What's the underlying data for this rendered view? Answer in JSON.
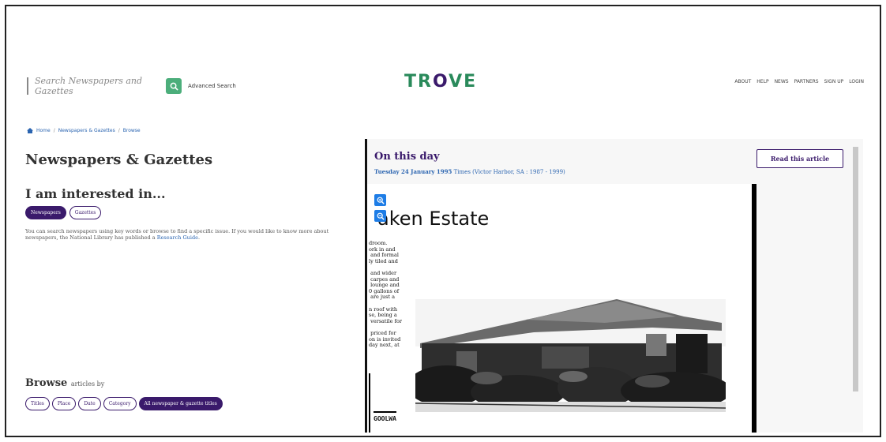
{
  "header": {
    "search_placeholder": "Search Newspapers and Gazettes",
    "advanced_search": "Advanced Search",
    "logo_left": "TR",
    "logo_o": "O",
    "logo_right": "VE",
    "nav": [
      "ABOUT",
      "HELP",
      "NEWS",
      "PARTNERS",
      "SIGN UP",
      "LOGIN"
    ]
  },
  "breadcrumb": {
    "home": "Home",
    "sep": "/",
    "items": [
      "Newspapers & Gazettes",
      "Browse"
    ]
  },
  "main": {
    "title": "Newspapers & Gazettes",
    "interest_heading": "I am interested in...",
    "interest_pills": [
      "Newspapers",
      "Gazettes"
    ],
    "description": "You can search newspapers using key words or browse to find a specific issue. If you would like to know more about newspapers, the National Library has published a ",
    "description_link": "Research Guide",
    "description_end": ".",
    "browse_heading": "Browse",
    "browse_sub": "articles by",
    "browse_pills": [
      "Titles",
      "Place",
      "Date",
      "Category",
      "All newspaper & gazette titles"
    ]
  },
  "on_this_day": {
    "heading": "On this day",
    "date": "Tuesday 24 January 1995",
    "source": "Times (Victor Harbor, SA : 1987 - 1999)",
    "read_button": "Read this article",
    "headline": "aken Estate",
    "column_text": "droom.\nork in and\n and formal\nly tiled and\n\n and wider\n carpes and\n lounge and\n0 gallons of\n are just a\n\nn roof with\nse, being a\n versatile for\n\n priced for\non is invited\nday next, at",
    "footer_label": "GOOLWA"
  },
  "colors": {
    "purple": "#3a1a6b",
    "green": "#2a8a5b",
    "link_blue": "#2a64b0",
    "zoom_blue": "#1e7de6"
  }
}
